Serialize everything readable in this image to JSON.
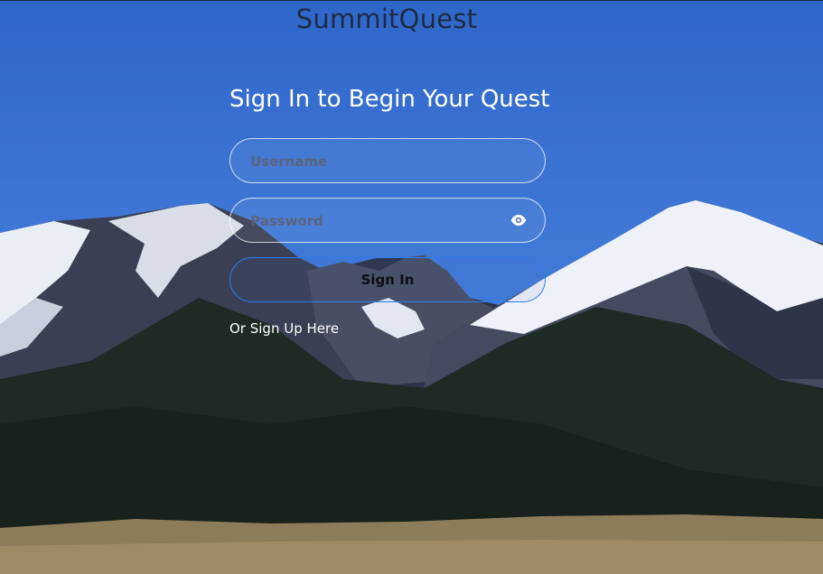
{
  "app": {
    "brand": "SummitQuest"
  },
  "login": {
    "heading": "Sign In to Begin Your Quest",
    "username_placeholder": "Username",
    "password_placeholder": "Password",
    "show_password_icon": "eye-icon",
    "sign_in_label": "Sign In",
    "sign_up_link": "Or Sign Up Here"
  },
  "colors": {
    "sky": "#3f77d6",
    "brand_text": "#1d2b45",
    "button_border": "#2d7cf0",
    "text_white": "#ffffff"
  }
}
